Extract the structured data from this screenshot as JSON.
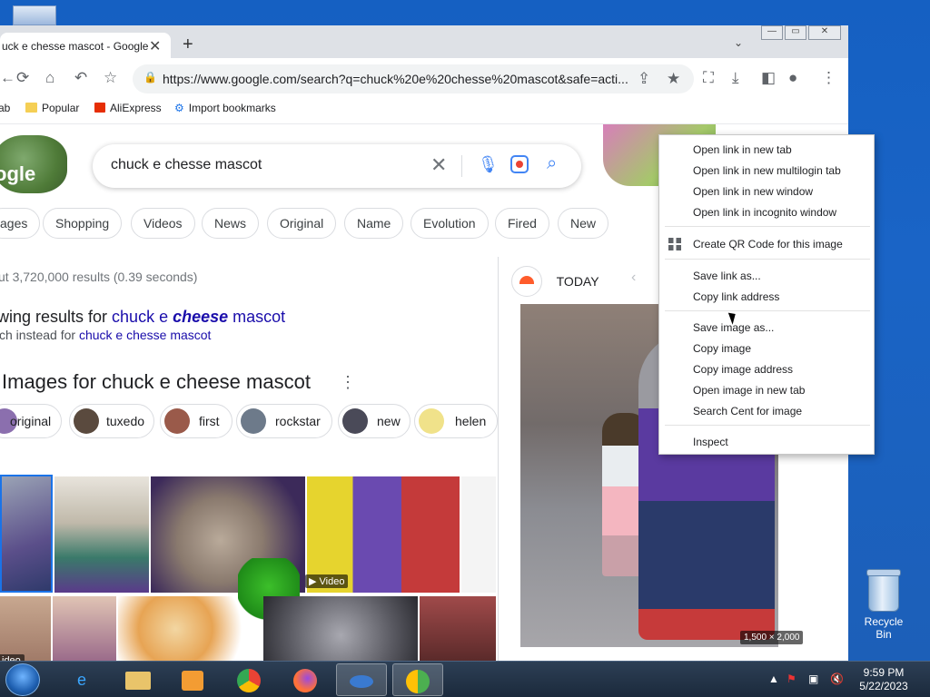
{
  "browser": {
    "tab_title": "uck e chesse mascot - Google",
    "tab_close": "✕",
    "new_tab": "+",
    "tab_search": "⌄",
    "url": "https://www.google.com/search?q=chuck%20e%20chesse%20mascot&safe=acti...",
    "window_controls": [
      "—",
      "▭",
      "✕"
    ]
  },
  "bookmarks": [
    {
      "label": "ab"
    },
    {
      "label": "Popular"
    },
    {
      "label": "AliExpress"
    },
    {
      "label": "Import bookmarks"
    }
  ],
  "search": {
    "logo_text": "ogle",
    "query": "chuck e chesse mascot",
    "chips": [
      "ages",
      "Shopping",
      "Videos",
      "News",
      "Original",
      "Name",
      "Evolution",
      "Fired",
      "New"
    ],
    "result_stats": "ut 3,720,000 results (0.39 seconds)",
    "showing_prefix": "wing results for ",
    "showing_link_1": "chuck e ",
    "showing_link_bold": "cheese",
    "showing_link_2": " mascot",
    "instead_prefix": "ch instead for ",
    "instead_link": "chuck e chesse mascot",
    "images_heading": "Images for chuck e cheese mascot",
    "image_pills": [
      "original",
      "tuxedo",
      "first",
      "rockstar",
      "new",
      "helen"
    ],
    "video_label": "▶ Video",
    "video_label_2": "ideo"
  },
  "side_panel": {
    "source_name": "TODAY",
    "dimensions": "1,500 × 2,000"
  },
  "context_menu": {
    "items": [
      "Open link in new tab",
      "Open link in new multilogin tab",
      "Open link in new window",
      "Open link in incognito window",
      "Create QR Code for this image",
      "Save link as...",
      "Copy link address",
      "Save image as...",
      "Copy image",
      "Copy image address",
      "Open image in new tab",
      "Search Cent for image",
      "Inspect"
    ]
  },
  "desktop": {
    "recycle_bin": "Recycle Bin"
  },
  "taskbar": {
    "time": "9:59 PM",
    "date": "5/22/2023"
  }
}
